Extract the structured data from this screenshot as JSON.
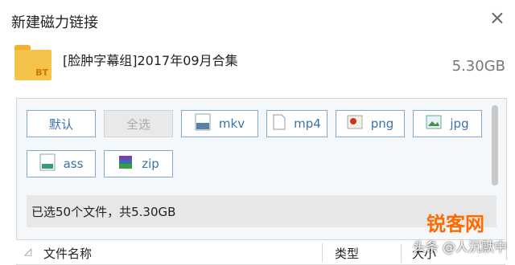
{
  "dialog": {
    "title": "新建磁力链接",
    "close_icon": "close-icon"
  },
  "task": {
    "folder_badge": "BT",
    "name": "[脸肿字幕组]2017年09月合集",
    "size": "5.30GB"
  },
  "filter_buttons": [
    {
      "label": "默认",
      "icon": "",
      "state": "normal"
    },
    {
      "label": "全选",
      "icon": "",
      "state": "disabled"
    },
    {
      "label": "mkv",
      "icon": "video-file-icon",
      "state": "normal"
    },
    {
      "label": "mp4",
      "icon": "file-icon",
      "state": "normal"
    },
    {
      "label": "png",
      "icon": "image-file-icon",
      "state": "normal"
    },
    {
      "label": "jpg",
      "icon": "image-file-icon",
      "state": "normal"
    },
    {
      "label": "ass",
      "icon": "subtitle-file-icon",
      "state": "normal"
    },
    {
      "label": "zip",
      "icon": "archive-icon",
      "state": "normal"
    }
  ],
  "summary": "已选50个文件，共5.30GB",
  "table": {
    "headers": [
      "文件名称",
      "类型",
      "大小"
    ]
  },
  "watermark": {
    "brand": "锐客网",
    "text": "头条 @人沉默中"
  },
  "colors": {
    "accent": "#3b73a8",
    "button_border": "#7fa9cf",
    "folder": "#f6c34a"
  }
}
